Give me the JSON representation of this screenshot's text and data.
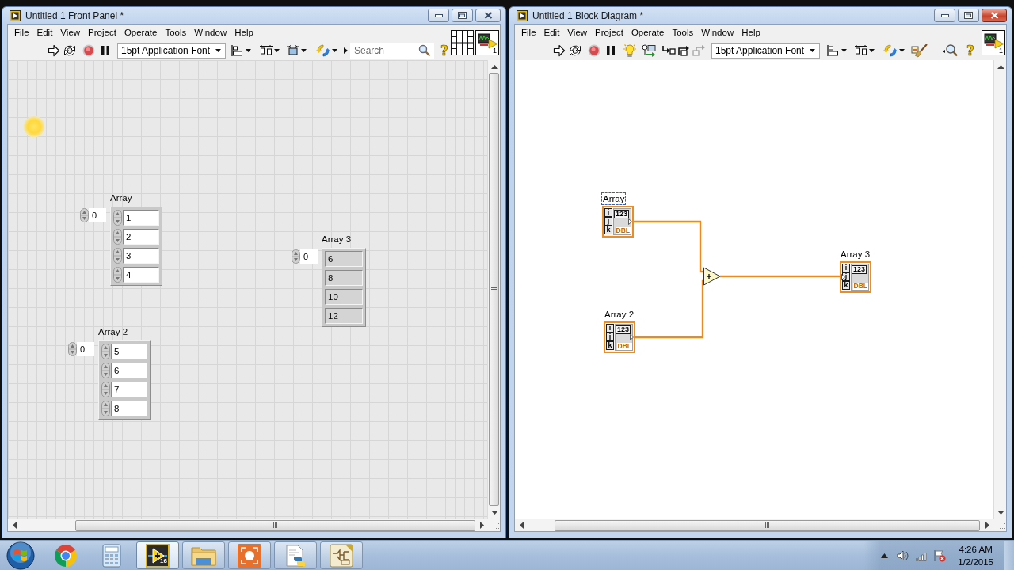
{
  "front_panel": {
    "title": "Untitled 1 Front Panel *",
    "active": false,
    "menu": [
      "File",
      "Edit",
      "View",
      "Project",
      "Operate",
      "Tools",
      "Window",
      "Help"
    ],
    "toolbar": [
      {
        "kind": "run"
      },
      {
        "kind": "run-continuous"
      },
      {
        "kind": "abort"
      },
      {
        "kind": "pause"
      },
      {
        "kind": "font",
        "label": "15pt Application Font"
      },
      {
        "kind": "align"
      },
      {
        "kind": "distribute"
      },
      {
        "kind": "resize"
      },
      {
        "kind": "reorder"
      },
      {
        "kind": "search",
        "placeholder": "Search"
      },
      {
        "kind": "help",
        "label": "?"
      }
    ],
    "connector_pane": true,
    "vi_icon": {
      "label": "1"
    },
    "arrays": [
      {
        "label": "Array",
        "kind": "control",
        "index": "0",
        "values": [
          "1",
          "2",
          "3",
          "4"
        ]
      },
      {
        "label": "Array 3",
        "kind": "indicator",
        "index": "0",
        "values": [
          "6",
          "8",
          "10",
          "12"
        ]
      },
      {
        "label": "Array 2",
        "kind": "control",
        "index": "0",
        "values": [
          "5",
          "6",
          "7",
          "8"
        ]
      }
    ]
  },
  "block_diagram": {
    "title": "Untitled 1 Block Diagram *",
    "active": true,
    "menu": [
      "File",
      "Edit",
      "View",
      "Project",
      "Operate",
      "Tools",
      "Window",
      "Help"
    ],
    "toolbar": [
      {
        "kind": "run",
        "disabled": false
      },
      {
        "kind": "run-continuous",
        "disabled": false
      },
      {
        "kind": "abort",
        "disabled": false
      },
      {
        "kind": "pause",
        "disabled": false
      },
      {
        "kind": "highlight",
        "disabled": false
      },
      {
        "kind": "retain",
        "disabled": false
      },
      {
        "kind": "step-into",
        "disabled": false
      },
      {
        "kind": "step-over",
        "disabled": false
      },
      {
        "kind": "step-out",
        "disabled": true
      },
      {
        "kind": "font",
        "label": "15pt Application Font",
        "disabled": false
      },
      {
        "kind": "align",
        "disabled": false
      },
      {
        "kind": "distribute",
        "disabled": false
      },
      {
        "kind": "reorder",
        "disabled": false
      },
      {
        "kind": "cleanup",
        "disabled": false
      },
      {
        "kind": "find",
        "disabled": false
      },
      {
        "kind": "help",
        "label": "?",
        "disabled": false
      }
    ],
    "vi_icon": {
      "label": "1"
    },
    "terminals": [
      {
        "label": "Array",
        "kind": "control",
        "selected": true,
        "dims": [
          "i",
          "j",
          "k"
        ],
        "display": "123",
        "type": "DBL"
      },
      {
        "label": "Array 3",
        "kind": "indicator",
        "selected": false,
        "dims": [
          "i",
          "j",
          "k"
        ],
        "display": "123",
        "type": "DBL"
      },
      {
        "label": "Array 2",
        "kind": "control",
        "selected": false,
        "dims": [
          "i",
          "j",
          "k"
        ],
        "display": "123",
        "type": "DBL"
      }
    ],
    "functions": [
      {
        "kind": "add"
      }
    ]
  },
  "taskbar": {
    "apps": [
      {
        "kind": "browser",
        "running": false,
        "selected": false
      },
      {
        "kind": "calculator",
        "running": false,
        "selected": false
      },
      {
        "kind": "vi-editor",
        "running": true,
        "selected": true,
        "badge": "16"
      },
      {
        "kind": "folder",
        "running": true,
        "selected": false
      },
      {
        "kind": "recorder",
        "running": true,
        "selected": false
      },
      {
        "kind": "script",
        "running": true,
        "selected": false
      },
      {
        "kind": "schematic",
        "running": true,
        "selected": false
      }
    ],
    "clock": {
      "time": "4:26 AM",
      "date": "1/2/2015"
    }
  }
}
